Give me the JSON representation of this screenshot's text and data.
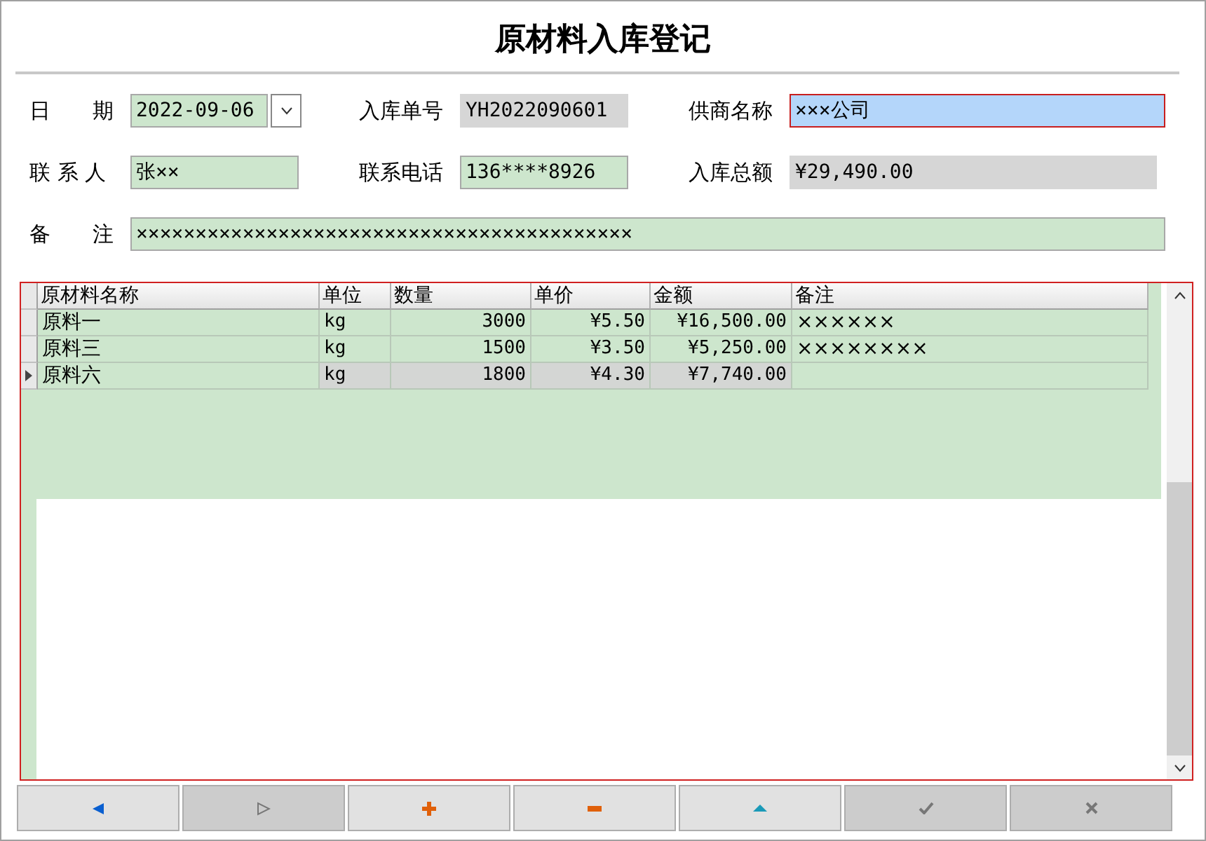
{
  "window": {
    "title": "原材料入库登记"
  },
  "form": [
    {
      "label": "日　　期",
      "kind": "date",
      "value": "2022-09-06",
      "focused": false
    },
    {
      "label": "入库单号",
      "kind": "readonly",
      "value": "YH2022090601",
      "focused": false
    },
    {
      "label": "供商名称",
      "kind": "input",
      "value": "×××公司",
      "focused": true
    },
    {
      "label": "联 系 人",
      "kind": "input",
      "value": "张××",
      "focused": false
    },
    {
      "label": "联系电话",
      "kind": "input",
      "value": "136****8926",
      "focused": false
    },
    {
      "label": "入库总额",
      "kind": "readonly",
      "value": "¥29,490.00",
      "focused": false
    },
    {
      "label": "备　　注",
      "kind": "wide",
      "value": "××××××××××××××××××××××××××××××××××××××××××",
      "focused": false
    }
  ],
  "table": {
    "columns": [
      "原材料名称",
      "单位",
      "数量",
      "单价",
      "金额",
      "备注"
    ],
    "rows": [
      {
        "cells": [
          "原料一",
          "kg",
          "3000",
          "¥5.50",
          "¥16,500.00",
          "××××××"
        ],
        "selected": false
      },
      {
        "cells": [
          "原料三",
          "kg",
          "1500",
          "¥3.50",
          "¥5,250.00",
          "××××××××"
        ],
        "selected": false
      },
      {
        "cells": [
          "原料六",
          "kg",
          "1800",
          "¥4.30",
          "¥7,740.00",
          ""
        ],
        "selected": true
      }
    ]
  },
  "toolbar": [
    {
      "kind": "previous",
      "disabled": false
    },
    {
      "kind": "next",
      "disabled": true
    },
    {
      "kind": "add",
      "disabled": false
    },
    {
      "kind": "remove",
      "disabled": false
    },
    {
      "kind": "up",
      "disabled": false
    },
    {
      "kind": "confirm",
      "disabled": true
    },
    {
      "kind": "cancel",
      "disabled": true
    }
  ]
}
